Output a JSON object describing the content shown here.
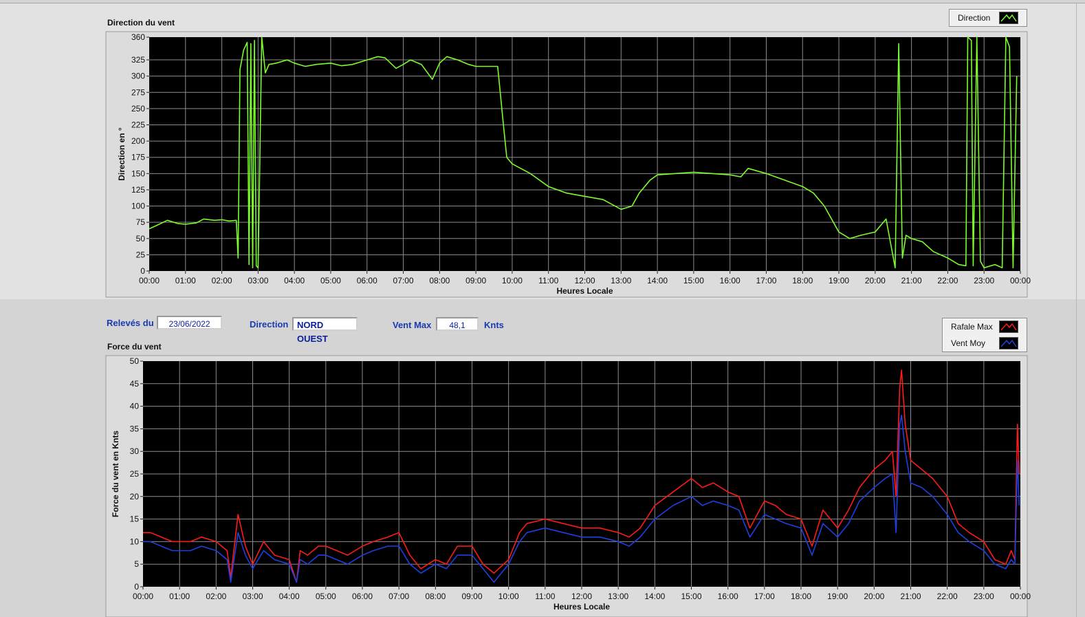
{
  "direction_panel": {
    "title": "Direction du vent",
    "legend": [
      {
        "label": "Direction",
        "color": "#7cfc2a"
      }
    ]
  },
  "info_bar": {
    "releves_label": "Relevés du",
    "releves_value": "23/06/2022",
    "direction_label": "Direction",
    "direction_value": "NORD OUEST",
    "ventmax_label": "Vent Max",
    "ventmax_value": "48,1",
    "ventmax_unit": "Knts"
  },
  "force_panel": {
    "title": "Force du vent",
    "legend": [
      {
        "label": "Rafale Max",
        "color": "#ff1a1a"
      },
      {
        "label": "Vent Moy",
        "color": "#1f3fe0"
      }
    ]
  },
  "chart_data": [
    {
      "type": "line",
      "ylabel": "Direction en °",
      "xlabel": "Heures Locale",
      "ylim": [
        0,
        360
      ],
      "yticks": [
        "0",
        "25",
        "50",
        "75",
        "100",
        "125",
        "150",
        "175",
        "200",
        "225",
        "250",
        "275",
        "300",
        "325",
        "360"
      ],
      "xticks": [
        "00:00",
        "01:00",
        "02:00",
        "03:00",
        "04:00",
        "05:00",
        "06:00",
        "07:00",
        "08:00",
        "09:00",
        "10:00",
        "11:00",
        "12:00",
        "13:00",
        "14:00",
        "15:00",
        "16:00",
        "17:00",
        "18:00",
        "19:00",
        "20:00",
        "21:00",
        "22:00",
        "23:00",
        "00:00"
      ],
      "grid": true,
      "legend": "top-right",
      "series": [
        {
          "name": "Direction",
          "color": "#7cfc2a",
          "x": [
            0,
            0.2,
            0.5,
            0.8,
            1.0,
            1.3,
            1.5,
            1.8,
            2.0,
            2.2,
            2.4,
            2.45,
            2.5,
            2.6,
            2.7,
            2.75,
            2.8,
            2.85,
            2.9,
            2.95,
            3.0,
            3.1,
            3.2,
            3.3,
            3.5,
            3.8,
            4.0,
            4.3,
            4.6,
            5.0,
            5.3,
            5.6,
            6.0,
            6.3,
            6.5,
            6.8,
            7.0,
            7.2,
            7.5,
            7.8,
            8.0,
            8.2,
            8.5,
            8.8,
            9.0,
            9.3,
            9.6,
            9.75,
            9.85,
            10.0,
            10.5,
            11.0,
            11.5,
            12.0,
            12.5,
            13.0,
            13.3,
            13.5,
            13.8,
            14.0,
            14.5,
            15.0,
            15.5,
            16.0,
            16.3,
            16.5,
            17.0,
            17.5,
            18.0,
            18.3,
            18.6,
            19.0,
            19.3,
            19.6,
            20.0,
            20.3,
            20.55,
            20.65,
            20.75,
            20.85,
            21.0,
            21.3,
            21.6,
            22.0,
            22.3,
            22.5,
            22.55,
            22.65,
            22.7,
            22.8,
            22.9,
            23.0,
            23.3,
            23.5,
            23.6,
            23.7,
            23.8,
            23.9
          ],
          "y": [
            65,
            70,
            78,
            73,
            72,
            74,
            80,
            78,
            79,
            77,
            78,
            20,
            310,
            340,
            352,
            10,
            350,
            5,
            355,
            8,
            5,
            360,
            305,
            318,
            320,
            325,
            320,
            315,
            318,
            320,
            316,
            318,
            325,
            330,
            328,
            312,
            318,
            325,
            318,
            295,
            320,
            330,
            325,
            318,
            315,
            315,
            315,
            230,
            175,
            165,
            150,
            130,
            120,
            115,
            110,
            95,
            100,
            120,
            140,
            148,
            150,
            152,
            150,
            148,
            145,
            158,
            150,
            140,
            130,
            120,
            100,
            60,
            50,
            55,
            60,
            80,
            5,
            350,
            20,
            55,
            50,
            45,
            30,
            20,
            10,
            8,
            360,
            355,
            8,
            360,
            15,
            5,
            10,
            5,
            360,
            345,
            5,
            300
          ]
        }
      ]
    },
    {
      "type": "line",
      "ylabel": "Force du vent en Knts",
      "xlabel": "Heures Locale",
      "ylim": [
        0,
        50
      ],
      "yticks": [
        "0",
        "5",
        "10",
        "15",
        "20",
        "25",
        "30",
        "35",
        "40",
        "45",
        "50"
      ],
      "xticks": [
        "00:00",
        "01:00",
        "02:00",
        "03:00",
        "04:00",
        "05:00",
        "06:00",
        "07:00",
        "08:00",
        "09:00",
        "10:00",
        "11:00",
        "12:00",
        "13:00",
        "14:00",
        "15:00",
        "16:00",
        "17:00",
        "18:00",
        "19:00",
        "20:00",
        "21:00",
        "22:00",
        "23:00",
        "00:00"
      ],
      "grid": true,
      "legend": "top-right",
      "series": [
        {
          "name": "Rafale Max",
          "color": "#ff1a1a",
          "x": [
            0,
            0.2,
            0.5,
            0.8,
            1.0,
            1.3,
            1.6,
            2.0,
            2.3,
            2.4,
            2.6,
            2.8,
            3.0,
            3.3,
            3.6,
            4.0,
            4.2,
            4.3,
            4.5,
            4.8,
            5.0,
            5.3,
            5.6,
            6.0,
            6.3,
            6.7,
            7.0,
            7.3,
            7.6,
            8.0,
            8.3,
            8.6,
            9.0,
            9.3,
            9.6,
            10.0,
            10.3,
            10.5,
            11.0,
            11.5,
            12.0,
            12.5,
            13.0,
            13.3,
            13.6,
            14.0,
            14.5,
            15.0,
            15.3,
            15.6,
            16.0,
            16.3,
            16.6,
            17.0,
            17.3,
            17.6,
            18.0,
            18.3,
            18.6,
            19.0,
            19.3,
            19.6,
            20.0,
            20.3,
            20.5,
            20.6,
            20.7,
            20.75,
            20.85,
            21.0,
            21.3,
            21.6,
            22.0,
            22.3,
            22.6,
            23.0,
            23.3,
            23.6,
            23.75,
            23.85,
            23.92,
            23.97
          ],
          "y": [
            12,
            12,
            11,
            10,
            10,
            10,
            11,
            10,
            8,
            2,
            16,
            9,
            5,
            10,
            7,
            6,
            1,
            8,
            7,
            9,
            9,
            8,
            7,
            9,
            10,
            11,
            12,
            7,
            4,
            6,
            5,
            9,
            9,
            5,
            3,
            6,
            12,
            14,
            15,
            14,
            13,
            13,
            12,
            11,
            13,
            18,
            21,
            24,
            22,
            23,
            21,
            20,
            13,
            19,
            18,
            16,
            15,
            9,
            17,
            13,
            17,
            22,
            26,
            28,
            30,
            20,
            44,
            48,
            36,
            28,
            26,
            24,
            20,
            14,
            12,
            10,
            6,
            5,
            8,
            6,
            36,
            25
          ]
        },
        {
          "name": "Vent Moy",
          "color": "#1f3fe0",
          "x": [
            0,
            0.2,
            0.5,
            0.8,
            1.0,
            1.3,
            1.6,
            2.0,
            2.3,
            2.4,
            2.6,
            2.8,
            3.0,
            3.3,
            3.6,
            4.0,
            4.2,
            4.3,
            4.5,
            4.8,
            5.0,
            5.3,
            5.6,
            6.0,
            6.3,
            6.7,
            7.0,
            7.3,
            7.6,
            8.0,
            8.3,
            8.6,
            9.0,
            9.3,
            9.6,
            10.0,
            10.3,
            10.5,
            11.0,
            11.5,
            12.0,
            12.5,
            13.0,
            13.3,
            13.6,
            14.0,
            14.5,
            15.0,
            15.3,
            15.6,
            16.0,
            16.3,
            16.6,
            17.0,
            17.3,
            17.6,
            18.0,
            18.3,
            18.6,
            19.0,
            19.3,
            19.6,
            20.0,
            20.3,
            20.5,
            20.6,
            20.7,
            20.75,
            20.85,
            21.0,
            21.3,
            21.6,
            22.0,
            22.3,
            22.6,
            23.0,
            23.3,
            23.6,
            23.75,
            23.85,
            23.92,
            23.97
          ],
          "y": [
            10,
            10,
            9,
            8,
            8,
            8,
            9,
            8,
            6,
            1,
            12,
            7,
            4,
            8,
            6,
            5,
            1,
            6,
            5,
            7,
            7,
            6,
            5,
            7,
            8,
            9,
            9,
            5,
            3,
            5,
            4,
            7,
            7,
            4,
            1,
            5,
            10,
            12,
            13,
            12,
            11,
            11,
            10,
            9,
            11,
            15,
            18,
            20,
            18,
            19,
            18,
            17,
            11,
            16,
            15,
            14,
            13,
            7,
            14,
            11,
            14,
            19,
            22,
            24,
            25,
            12,
            36,
            38,
            30,
            23,
            22,
            20,
            16,
            12,
            10,
            8,
            5,
            4,
            6,
            5,
            28,
            18
          ]
        }
      ]
    }
  ]
}
